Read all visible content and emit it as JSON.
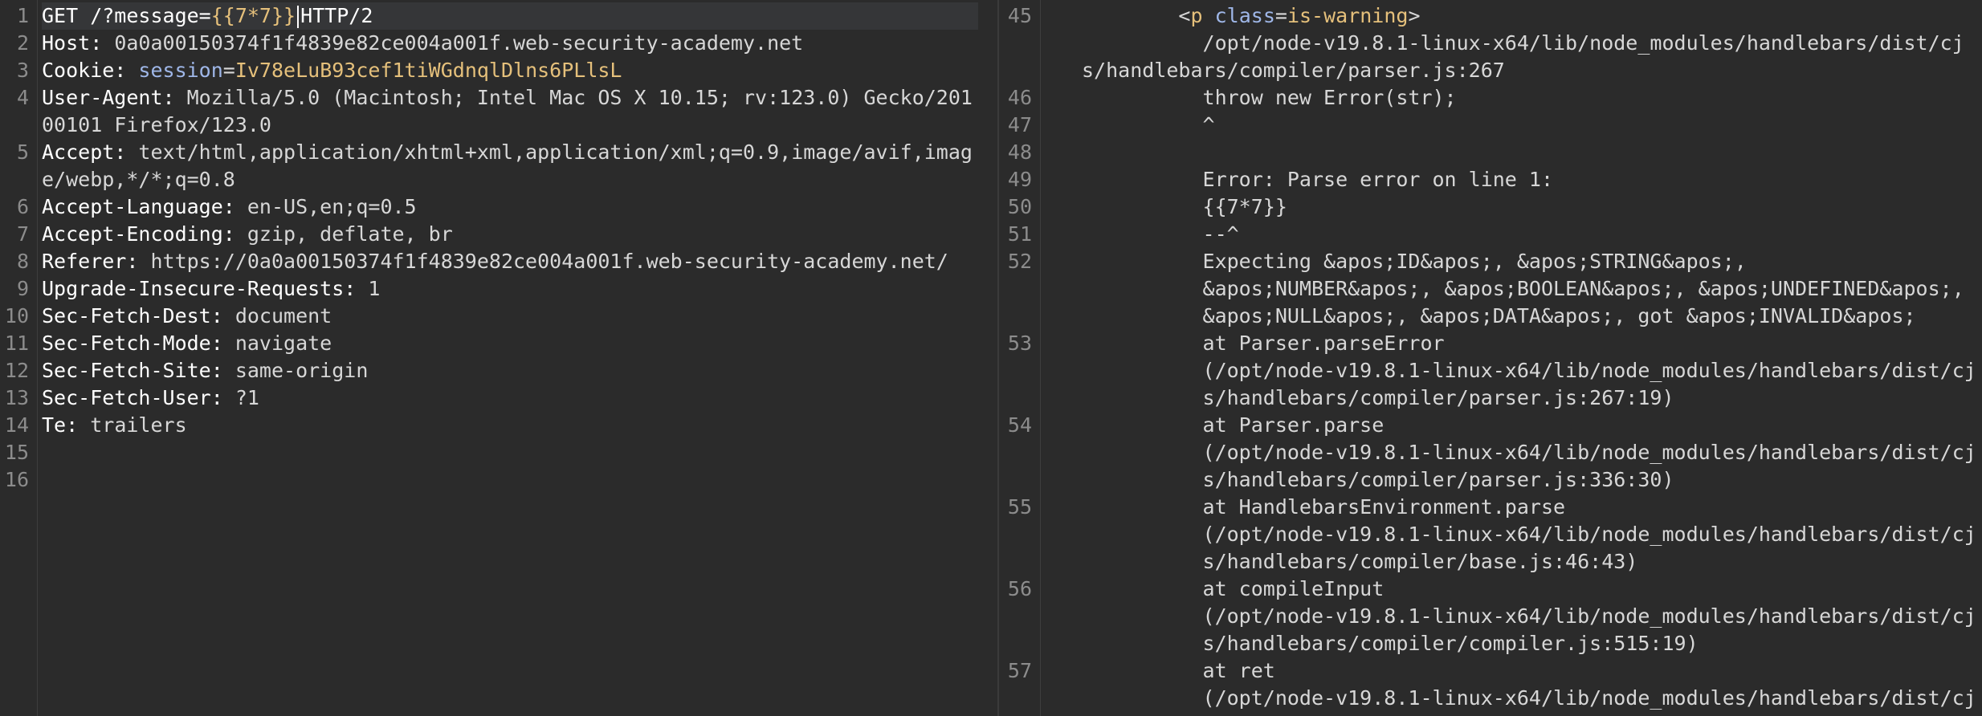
{
  "request": {
    "lines": [
      {
        "n": "1",
        "parts": [
          {
            "t": "GET /?message=",
            "c": "k"
          },
          {
            "t": "{{7*7}}",
            "c": "hl"
          },
          {
            "t": "",
            "c": "caret"
          },
          {
            "t": "HTTP/2",
            "c": "k"
          }
        ],
        "current": true
      },
      {
        "n": "2",
        "parts": [
          {
            "t": "Host: ",
            "c": "k"
          },
          {
            "t": "0a0a00150374f1f4839e82ce004a001f.web-security-academy.net",
            "c": "v"
          }
        ]
      },
      {
        "n": "3",
        "parts": [
          {
            "t": "Cookie: ",
            "c": "k"
          },
          {
            "t": "session",
            "c": "attr"
          },
          {
            "t": "=",
            "c": "v"
          },
          {
            "t": "Iv78eLuB93cef1tiWGdnqlDlns6PLlsL",
            "c": "hl"
          }
        ]
      },
      {
        "n": "4",
        "parts": [
          {
            "t": "User-Agent: ",
            "c": "k"
          },
          {
            "t": "Mozilla/5.0 (Macintosh; Intel Mac OS X 10.15; rv:123.0) Gecko/20100101 Firefox/123.0",
            "c": "v"
          }
        ]
      },
      {
        "n": "5",
        "parts": [
          {
            "t": "Accept: ",
            "c": "k"
          },
          {
            "t": "text/html,application/xhtml+xml,application/xml;q=0.9,image/avif,image/webp,*/*;q=0.8",
            "c": "v"
          }
        ]
      },
      {
        "n": "6",
        "parts": [
          {
            "t": "Accept-Language: ",
            "c": "k"
          },
          {
            "t": "en-US,en;q=0.5",
            "c": "v"
          }
        ]
      },
      {
        "n": "7",
        "parts": [
          {
            "t": "Accept-Encoding: ",
            "c": "k"
          },
          {
            "t": "gzip, deflate, br",
            "c": "v"
          }
        ]
      },
      {
        "n": "8",
        "parts": [
          {
            "t": "Referer: ",
            "c": "k"
          },
          {
            "t": "https://0a0a00150374f1f4839e82ce004a001f.web-security-academy.net/",
            "c": "v"
          }
        ]
      },
      {
        "n": "9",
        "parts": [
          {
            "t": "Upgrade-Insecure-Requests: ",
            "c": "k"
          },
          {
            "t": "1",
            "c": "v"
          }
        ]
      },
      {
        "n": "10",
        "parts": [
          {
            "t": "Sec-Fetch-Dest: ",
            "c": "k"
          },
          {
            "t": "document",
            "c": "v"
          }
        ]
      },
      {
        "n": "11",
        "parts": [
          {
            "t": "Sec-Fetch-Mode: ",
            "c": "k"
          },
          {
            "t": "navigate",
            "c": "v"
          }
        ]
      },
      {
        "n": "12",
        "parts": [
          {
            "t": "Sec-Fetch-Site: ",
            "c": "k"
          },
          {
            "t": "same-origin",
            "c": "v"
          }
        ]
      },
      {
        "n": "13",
        "parts": [
          {
            "t": "Sec-Fetch-User: ",
            "c": "k"
          },
          {
            "t": "?1",
            "c": "v"
          }
        ]
      },
      {
        "n": "14",
        "parts": [
          {
            "t": "Te: ",
            "c": "k"
          },
          {
            "t": "trailers",
            "c": "v"
          }
        ]
      },
      {
        "n": "15",
        "parts": []
      },
      {
        "n": "16",
        "parts": []
      }
    ]
  },
  "response": {
    "lines": [
      {
        "n": "45",
        "parts": [
          {
            "t": "        <",
            "c": "v"
          },
          {
            "t": "p",
            "c": "tagn"
          },
          {
            "t": " ",
            "c": "v"
          },
          {
            "t": "class",
            "c": "attr"
          },
          {
            "t": "=",
            "c": "v"
          },
          {
            "t": "is-warning",
            "c": "hl"
          },
          {
            "t": ">",
            "c": "v"
          }
        ]
      },
      {
        "n": "",
        "parts": [
          {
            "t": "          /opt/node-v19.8.1-linux-x64/lib/node_modules/handlebars/dist/cjs/handlebars/compiler/parser.js:267",
            "c": "v"
          }
        ]
      },
      {
        "n": "46",
        "parts": [
          {
            "t": "          throw new Error(str);",
            "c": "v"
          }
        ]
      },
      {
        "n": "47",
        "parts": [
          {
            "t": "          ^",
            "c": "v"
          }
        ]
      },
      {
        "n": "48",
        "parts": []
      },
      {
        "n": "49",
        "parts": [
          {
            "t": "          Error: Parse error on line 1:",
            "c": "v"
          }
        ]
      },
      {
        "n": "50",
        "parts": [
          {
            "t": "          {{7*7}}",
            "c": "v"
          }
        ]
      },
      {
        "n": "51",
        "parts": [
          {
            "t": "          --^",
            "c": "v"
          }
        ]
      },
      {
        "n": "52",
        "parts": [
          {
            "t": "          Expecting &apos;ID&apos;, &apos;STRING&apos;,\n          &apos;NUMBER&apos;, &apos;BOOLEAN&apos;, &apos;UNDEFINED&apos;,\n          &apos;NULL&apos;, &apos;DATA&apos;, got &apos;INVALID&apos;",
            "c": "v"
          }
        ]
      },
      {
        "n": "53",
        "parts": [
          {
            "t": "          at Parser.parseError\n          (/opt/node-v19.8.1-linux-x64/lib/node_modules/handlebars/dist/cj\n          s/handlebars/compiler/parser.js:267:19)",
            "c": "v"
          }
        ]
      },
      {
        "n": "54",
        "parts": [
          {
            "t": "          at Parser.parse\n          (/opt/node-v19.8.1-linux-x64/lib/node_modules/handlebars/dist/cj\n          s/handlebars/compiler/parser.js:336:30)",
            "c": "v"
          }
        ]
      },
      {
        "n": "55",
        "parts": [
          {
            "t": "          at HandlebarsEnvironment.parse\n          (/opt/node-v19.8.1-linux-x64/lib/node_modules/handlebars/dist/cj\n          s/handlebars/compiler/base.js:46:43)",
            "c": "v"
          }
        ]
      },
      {
        "n": "56",
        "parts": [
          {
            "t": "          at compileInput\n          (/opt/node-v19.8.1-linux-x64/lib/node_modules/handlebars/dist/cj\n          s/handlebars/compiler/compiler.js:515:19)",
            "c": "v"
          }
        ]
      },
      {
        "n": "57",
        "parts": [
          {
            "t": "          at ret\n          (/opt/node-v19.8.1-linux-x64/lib/node_modules/handlebars/dist/cj",
            "c": "v"
          }
        ]
      }
    ]
  }
}
